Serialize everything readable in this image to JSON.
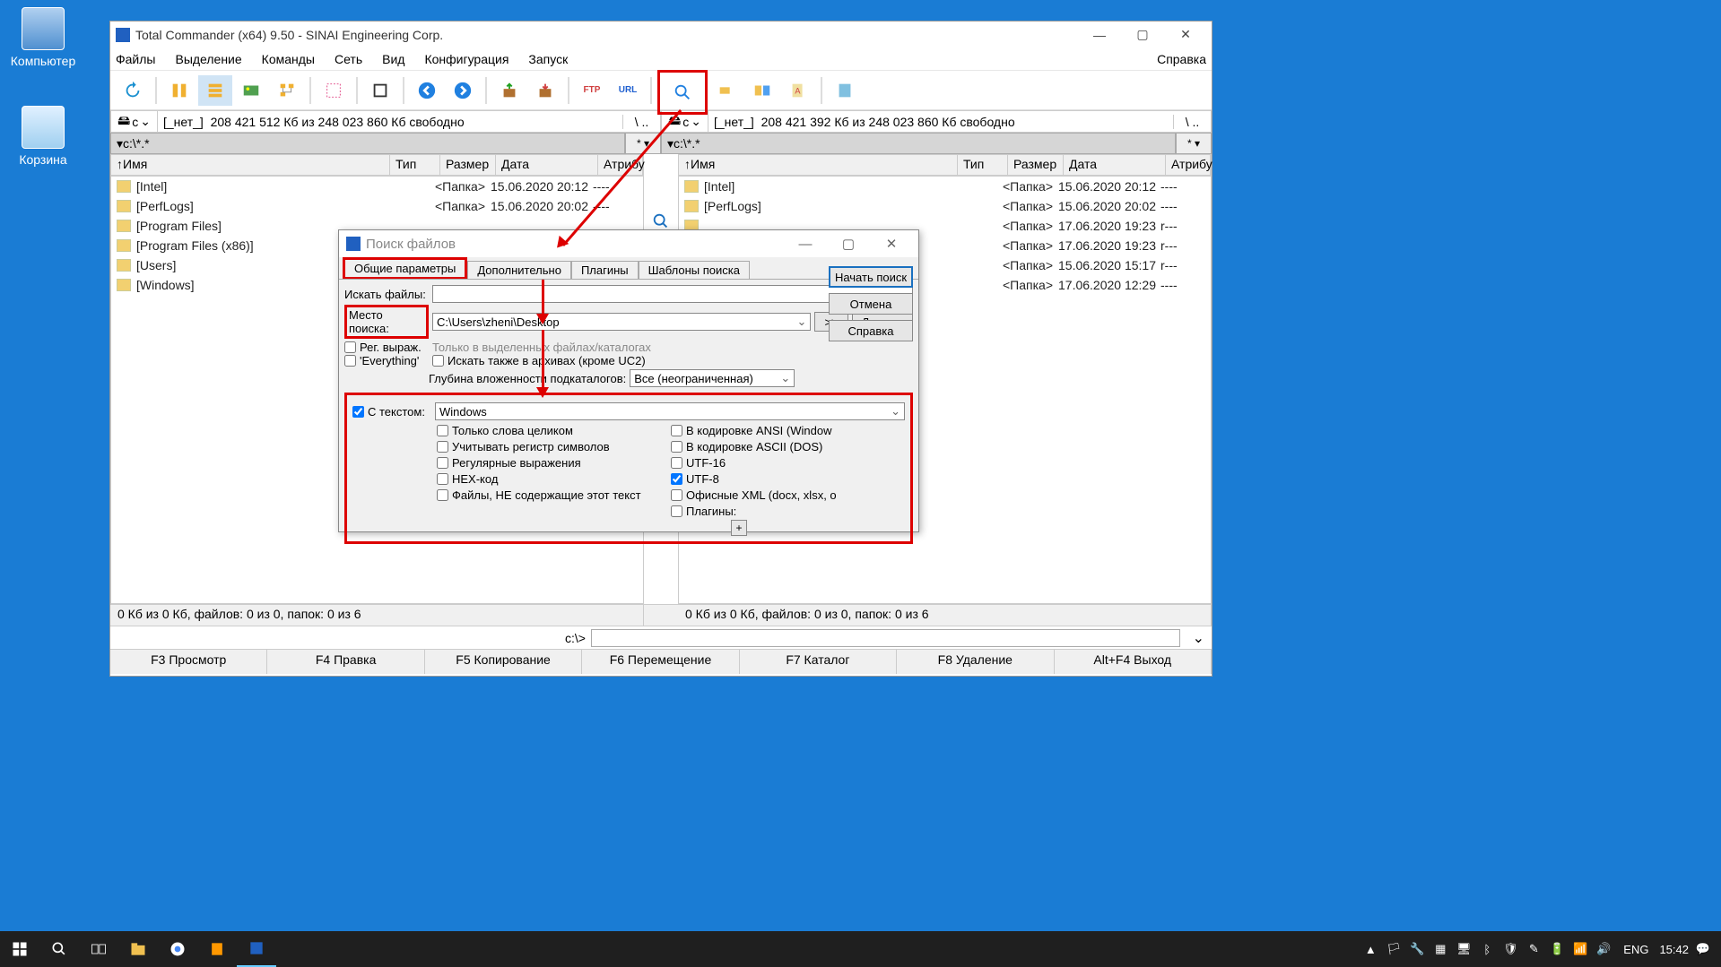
{
  "desktop": {
    "computer": "Компьютер",
    "recycle": "Корзина"
  },
  "tc": {
    "title": "Total Commander (x64) 9.50 - SINAI Engineering Corp.",
    "menu": [
      "Файлы",
      "Выделение",
      "Команды",
      "Сеть",
      "Вид",
      "Конфигурация",
      "Запуск"
    ],
    "menu_right": "Справка",
    "drive_left": {
      "letter": "c",
      "none": "[_нет_]",
      "free": "208 421 512 Кб из 248 023 860 Кб свободно",
      "dots": "\\ .."
    },
    "drive_right": {
      "letter": "c",
      "none": "[_нет_]",
      "free": "208 421 392 Кб из 248 023 860 Кб свободно",
      "dots": "\\ .."
    },
    "path_left": "c:\\*.*",
    "path_right": "c:\\*.*",
    "pbtn": "* ▾",
    "headers": {
      "up": "↑",
      "name": "Имя",
      "type": "Тип",
      "size": "Размер",
      "date": "Дата",
      "attr": "Атрибу"
    },
    "files_left": [
      {
        "name": "[Intel]",
        "size": "<Папка>",
        "date": "15.06.2020 20:12",
        "attr": "----"
      },
      {
        "name": "[PerfLogs]",
        "size": "<Папка>",
        "date": "15.06.2020 20:02",
        "attr": "----"
      },
      {
        "name": "[Program Files]",
        "size": "",
        "date": "",
        "attr": ""
      },
      {
        "name": "[Program Files (x86)]",
        "size": "",
        "date": "",
        "attr": ""
      },
      {
        "name": "[Users]",
        "size": "",
        "date": "",
        "attr": ""
      },
      {
        "name": "[Windows]",
        "size": "",
        "date": "",
        "attr": ""
      }
    ],
    "files_right": [
      {
        "name": "[Intel]",
        "size": "<Папка>",
        "date": "15.06.2020 20:12",
        "attr": "----"
      },
      {
        "name": "[PerfLogs]",
        "size": "<Папка>",
        "date": "15.06.2020 20:02",
        "attr": "----"
      },
      {
        "name": "",
        "size": "<Папка>",
        "date": "17.06.2020 19:23",
        "attr": "r---"
      },
      {
        "name": "",
        "size": "<Папка>",
        "date": "17.06.2020 19:23",
        "attr": "r---"
      },
      {
        "name": "",
        "size": "<Папка>",
        "date": "15.06.2020 15:17",
        "attr": "r---"
      },
      {
        "name": "",
        "size": "<Папка>",
        "date": "17.06.2020 12:29",
        "attr": "----"
      }
    ],
    "status": "0 Кб из 0 Кб, файлов: 0 из 0, папок: 0 из 6",
    "cmd_label": "c:\\>",
    "fkeys": [
      "F3 Просмотр",
      "F4 Правка",
      "F5 Копирование",
      "F6 Перемещение",
      "F7 Каталог",
      "F8 Удаление",
      "Alt+F4 Выход"
    ]
  },
  "search": {
    "title": "Поиск файлов",
    "tabs": [
      "Общие параметры",
      "Дополнительно",
      "Плагины",
      "Шаблоны поиска"
    ],
    "label_files": "Искать файлы:",
    "label_place": "Место поиска:",
    "place_value": "C:\\Users\\zheni\\Desktop",
    "btn_expand": ">>",
    "btn_disks": "Диски...",
    "chk_regex": "Рег. выраж.",
    "chk_everything": "'Everything'",
    "hint_selected": "Только в выделенных файлах/каталогах",
    "chk_archives": "Искать также в архивах (кроме UC2)",
    "label_depth": "Глубина вложенности подкаталогов:",
    "depth_value": "Все (неограниченная)",
    "chk_withtext": "С текстом:",
    "text_value": "Windows",
    "checks_left": [
      "Только слова целиком",
      "Учитывать регистр символов",
      "Регулярные выражения",
      "HEX-код",
      "Файлы, НЕ содержащие этот текст"
    ],
    "checks_right": [
      "В кодировке ANSI (Window",
      "В кодировке ASCII (DOS)",
      "UTF-16",
      "UTF-8",
      "Офисные XML (docx, xlsx, o",
      "Плагины:"
    ],
    "utf8_checked": true,
    "btn_start": "Начать поиск",
    "btn_cancel": "Отмена",
    "btn_help": "Справка"
  },
  "taskbar": {
    "lang": "ENG",
    "time": "15:42"
  }
}
